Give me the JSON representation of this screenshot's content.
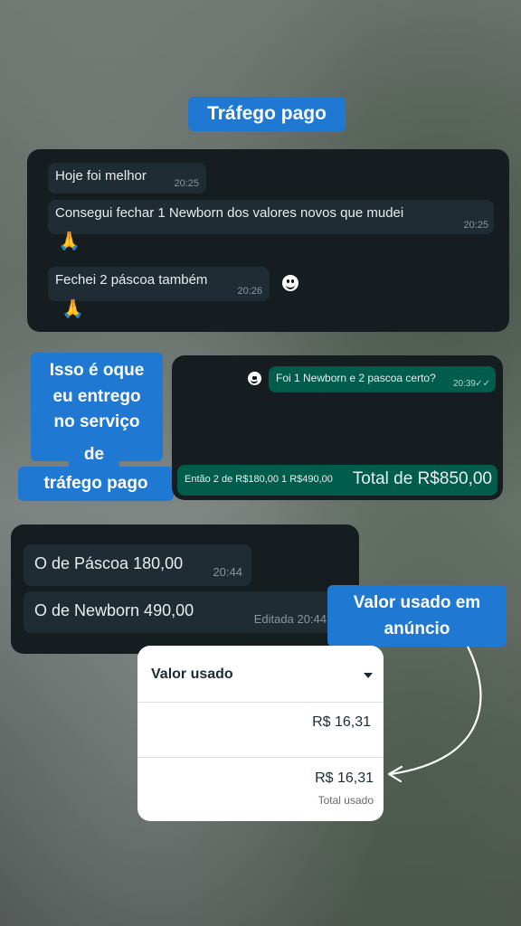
{
  "tags": {
    "top": "Tráfego pago",
    "left_lines": [
      "Isso é oque",
      "eu entrego",
      "no serviço",
      "de",
      "tráfego pago"
    ],
    "ad": "Valor usado em anúncio"
  },
  "chat1": {
    "m1": {
      "text": "Hoje foi melhor",
      "time": "20:25"
    },
    "m2": {
      "text": "Consegui fechar 1 Newborn dos valores novos que mudei",
      "time": "20:25"
    },
    "m3": {
      "text": "Fechei 2 páscoa também",
      "time": "20:26"
    },
    "pray": "🙏"
  },
  "chat2": {
    "out1": {
      "text": "Foi 1 Newborn e 2 pascoa certo?",
      "time": "20:39"
    },
    "out2": {
      "text": "Então 2 de R$180,00 1 R$490,00",
      "total": "Total de R$850,00"
    }
  },
  "chat3": {
    "m1": {
      "text": "O de Páscoa 180,00",
      "time": "20:44"
    },
    "m2": {
      "text": "O de Newborn 490,00",
      "time": "Editada 20:44"
    }
  },
  "card": {
    "header": "Valor usado",
    "row1": "R$ 16,31",
    "row2": "R$ 16,31",
    "row2_sub": "Total usado"
  }
}
